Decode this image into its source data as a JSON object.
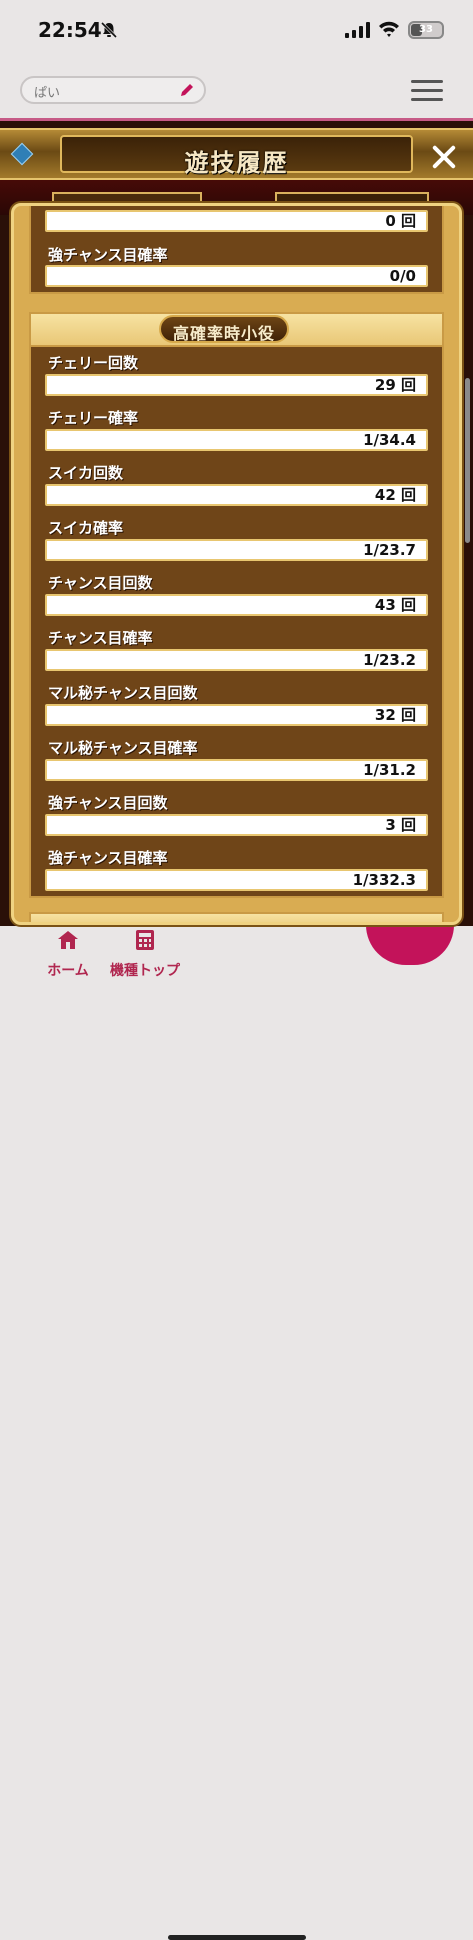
{
  "status_bar": {
    "time": "22:54",
    "battery": "33"
  },
  "header": {
    "search_value": "ぱい"
  },
  "modal": {
    "title": "遊技履歴",
    "top_rows": [
      {
        "label": "",
        "value": "0 回"
      },
      {
        "label": "強チャンス目確率",
        "value": "0/0"
      }
    ],
    "section_title": "高確率時小役",
    "rows": [
      {
        "label": "チェリー回数",
        "value": "29 回"
      },
      {
        "label": "チェリー確率",
        "value": "1/34.4"
      },
      {
        "label": "スイカ回数",
        "value": "42 回"
      },
      {
        "label": "スイカ確率",
        "value": "1/23.7"
      },
      {
        "label": "チャンス目回数",
        "value": "43 回"
      },
      {
        "label": "チャンス目確率",
        "value": "1/23.2"
      },
      {
        "label": "マル秘チャンス目回数",
        "value": "32 回"
      },
      {
        "label": "マル秘チャンス目確率",
        "value": "1/31.2"
      },
      {
        "label": "強チャンス目回数",
        "value": "3 回"
      },
      {
        "label": "強チャンス目確率",
        "value": "1/332.3"
      }
    ]
  },
  "bottom_nav": [
    {
      "label": "ホーム",
      "icon": "home-icon"
    },
    {
      "label": "機種トップ",
      "icon": "calculator-icon"
    }
  ]
}
